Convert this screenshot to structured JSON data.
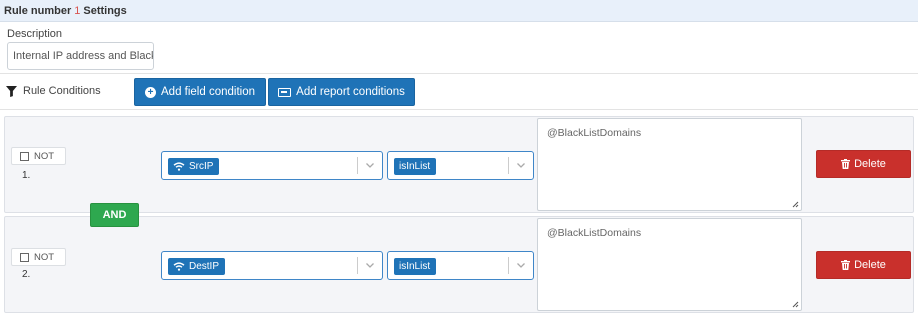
{
  "header": {
    "title": "Rule number",
    "rule_number": "1",
    "suffix": "Settings"
  },
  "description": {
    "label": "Description",
    "value": "Internal IP address and Black"
  },
  "conditions_section": {
    "label": "Rule Conditions",
    "add_field_label": "Add field condition",
    "add_report_label": "Add report conditions"
  },
  "operator_badge": "AND",
  "rows": [
    {
      "not_label": "NOT",
      "index": "1.",
      "field": "SrcIP",
      "operator": "isInList",
      "value": "@BlackListDomains",
      "delete_label": "Delete"
    },
    {
      "not_label": "NOT",
      "index": "2.",
      "field": "DestIP",
      "operator": "isInList",
      "value": "@BlackListDomains",
      "delete_label": "Delete"
    }
  ],
  "colors": {
    "primary": "#1f73b7",
    "danger": "#c9302c",
    "success": "#2ea84f",
    "header_bg": "#e8f0fa"
  }
}
